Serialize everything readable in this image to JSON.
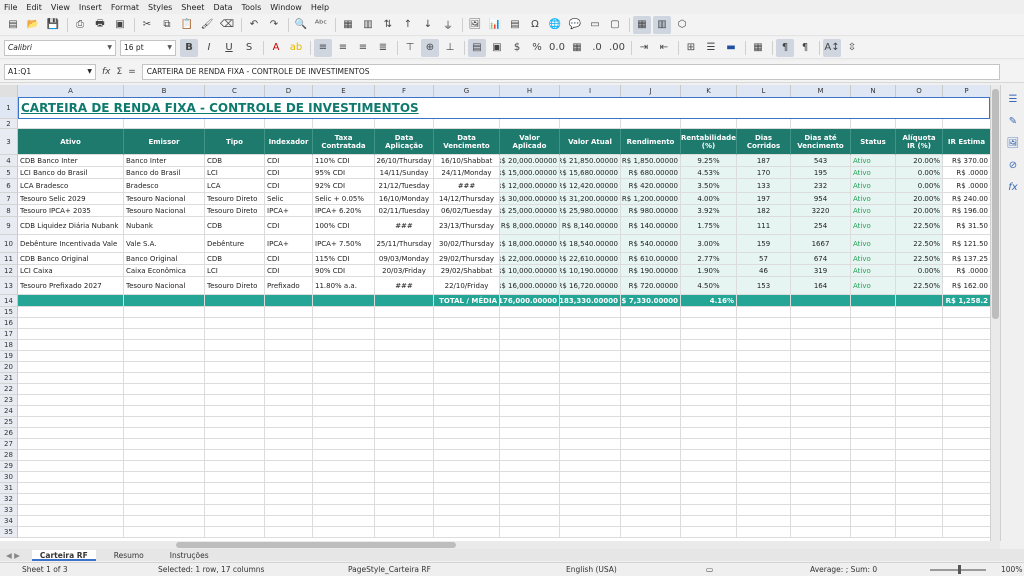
{
  "menu": [
    "File",
    "Edit",
    "View",
    "Insert",
    "Format",
    "Styles",
    "Sheet",
    "Data",
    "Tools",
    "Window",
    "Help"
  ],
  "font": {
    "name": "Calibri",
    "size": "16 pt"
  },
  "name_box": "A1:Q1",
  "formula": "CARTEIRA DE RENDA FIXA - CONTROLE DE INVESTIMENTOS",
  "title": "CARTEIRA DE RENDA FIXA - CONTROLE DE INVESTIMENTOS",
  "columns": [
    "A",
    "B",
    "C",
    "D",
    "E",
    "F",
    "G",
    "H",
    "I",
    "J",
    "K",
    "L",
    "M",
    "N",
    "O",
    "P"
  ],
  "headers": [
    "Ativo",
    "Emissor",
    "Tipo",
    "Indexador",
    "Taxa Contratada",
    "Data Aplicação",
    "Data Vencimento",
    "Valor Aplicado",
    "Valor Atual",
    "Rendimento",
    "Rentabilidade (%)",
    "Dias Corridos",
    "Dias até Vencimento",
    "Status",
    "Alíquota IR (%)",
    "IR Estima"
  ],
  "rows": [
    [
      "CDB Banco Inter",
      "Banco Inter",
      "CDB",
      "CDI",
      "110% CDI",
      "26/10/Thursday",
      "16/10/Shabbat",
      "R$ 20,000.00000",
      "R$ 21,850.00000",
      "R$ 1,850.00000",
      "9.25%",
      "187",
      "543",
      "Ativo",
      "20.00%",
      "R$ 370.00"
    ],
    [
      "LCI Banco do Brasil",
      "Banco do Brasil",
      "LCI",
      "CDI",
      "95% CDI",
      "14/11/Sunday",
      "24/11/Monday",
      "R$ 15,000.00000",
      "R$ 15,680.00000",
      "R$ 680.00000",
      "4.53%",
      "170",
      "195",
      "Ativo",
      "0.00%",
      "R$ .0000"
    ],
    [
      "LCA Bradesco",
      "Bradesco",
      "LCA",
      "CDI",
      "92% CDI",
      "21/12/Tuesday",
      "###",
      "R$ 12,000.00000",
      "R$ 12,420.00000",
      "R$ 420.00000",
      "3.50%",
      "133",
      "232",
      "Ativo",
      "0.00%",
      "R$ .0000"
    ],
    [
      "Tesouro Selic 2029",
      "Tesouro Nacional",
      "Tesouro Direto",
      "Selic",
      "Selic + 0.05%",
      "16/10/Monday",
      "14/12/Thursday",
      "R$ 30,000.00000",
      "R$ 31,200.00000",
      "R$ 1,200.00000",
      "4.00%",
      "197",
      "954",
      "Ativo",
      "20.00%",
      "R$ 240.00"
    ],
    [
      "Tesouro IPCA+ 2035",
      "Tesouro Nacional",
      "Tesouro Direto",
      "IPCA+",
      "IPCA+ 6.20%",
      "02/11/Tuesday",
      "06/02/Tuesday",
      "R$ 25,000.00000",
      "R$ 25,980.00000",
      "R$ 980.00000",
      "3.92%",
      "182",
      "3220",
      "Ativo",
      "20.00%",
      "R$ 196.00"
    ],
    [
      "CDB Liquidez Diária Nubank",
      "Nubank",
      "CDB",
      "CDI",
      "100% CDI",
      "###",
      "23/13/Thursday",
      "R$ 8,000.00000",
      "R$ 8,140.00000",
      "R$ 140.00000",
      "1.75%",
      "111",
      "254",
      "Ativo",
      "22.50%",
      "R$ 31.50"
    ],
    [
      "Debênture Incentivada Vale",
      "Vale S.A.",
      "Debênture",
      "IPCA+",
      "IPCA+ 7.50%",
      "25/11/Thursday",
      "30/02/Thursday",
      "R$ 18,000.00000",
      "R$ 18,540.00000",
      "R$ 540.00000",
      "3.00%",
      "159",
      "1667",
      "Ativo",
      "22.50%",
      "R$ 121.50"
    ],
    [
      "CDB Banco Original",
      "Banco Original",
      "CDB",
      "CDI",
      "115% CDI",
      "09/03/Monday",
      "29/02/Thursday",
      "R$ 22,000.00000",
      "R$ 22,610.00000",
      "R$ 610.00000",
      "2.77%",
      "57",
      "674",
      "Ativo",
      "22.50%",
      "R$ 137.25"
    ],
    [
      "LCI Caixa",
      "Caixa Econômica",
      "LCI",
      "CDI",
      "90% CDI",
      "20/03/Friday",
      "29/02/Shabbat",
      "R$ 10,000.00000",
      "R$ 10,190.00000",
      "R$ 190.00000",
      "1.90%",
      "46",
      "319",
      "Ativo",
      "0.00%",
      "R$ .0000"
    ],
    [
      "Tesouro Prefixado 2027",
      "Tesouro Nacional",
      "Tesouro Direto",
      "Prefixado",
      "11.80% a.a.",
      "###",
      "22/10/Friday",
      "R$ 16,000.00000",
      "R$ 16,720.00000",
      "R$ 720.00000",
      "4.50%",
      "153",
      "164",
      "Ativo",
      "22.50%",
      "R$ 162.00"
    ]
  ],
  "total": {
    "label": "TOTAL / MÉDIA",
    "aplicado": "R$ 176,000.00000",
    "atual": "R$ 183,330.00000",
    "rendimento": "R$ 7,330.00000",
    "rentab": "4.16%",
    "ir": "R$ 1,258.2"
  },
  "tabs": [
    "Carteira RF",
    "Resumo",
    "Instruções"
  ],
  "status": {
    "sheet": "Sheet 1 of 3",
    "selected": "Selected: 1 row, 17 columns",
    "pagestyle": "PageStyle_Carteira RF",
    "lang": "English (USA)",
    "sum": "Average: ; Sum: 0",
    "zoom": "100%"
  }
}
